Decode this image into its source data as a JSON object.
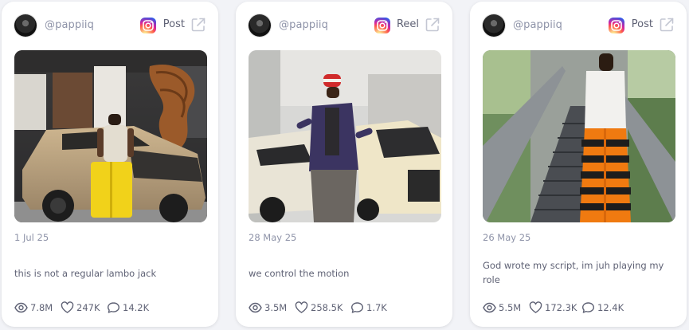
{
  "posts": [
    {
      "username": "@pappiiq",
      "type": "Post",
      "date": "1 Jul 25",
      "caption": "this is not a regular lambo jack",
      "views": "7.8M",
      "likes": "247K",
      "comments": "14.2K"
    },
    {
      "username": "@pappiiq",
      "type": "Reel",
      "date": "28 May 25",
      "caption": "we control the motion",
      "views": "3.5M",
      "likes": "258.5K",
      "comments": "1.7K"
    },
    {
      "username": "@pappiiq",
      "type": "Post",
      "date": "26 May 25",
      "caption": "God wrote my script, im juh playing my role",
      "views": "5.5M",
      "likes": "172.3K",
      "comments": "12.4K"
    }
  ],
  "icons": {
    "platform": "instagram-icon",
    "open": "external-link-icon",
    "views": "eye-icon",
    "likes": "heart-icon",
    "comments": "comment-icon"
  },
  "colors": {
    "muted_text": "#8e93a8",
    "body_text": "#5f6275",
    "card_bg": "#ffffff",
    "page_bg": "#f2f3f7"
  }
}
